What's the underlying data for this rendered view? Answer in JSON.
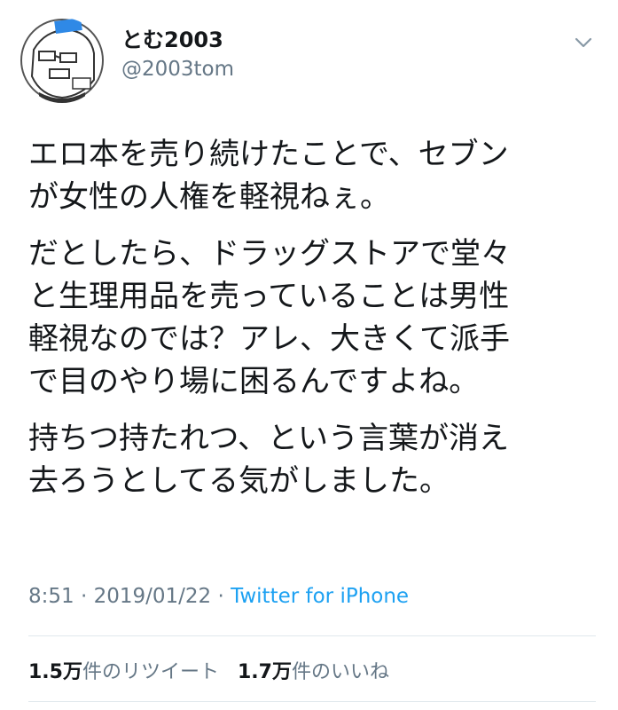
{
  "user": {
    "display_name": "とむ2003",
    "handle": "@2003tom",
    "avatar_icon": "cartoon-face-avatar-icon"
  },
  "menu_icon": "chevron-down-icon",
  "tweet": {
    "paragraphs": [
      "エロ本を売り続けたことで、セブン\nが女性の人権を軽視ねぇ。",
      "だとしたら、ドラッグストアで堂々\nと生理用品を売っていることは男性\n軽視なのでは？アレ、大きくて派手\nで目のやり場に困るんですよね。",
      "持ちつ持たれつ、という言葉が消え\n去ろうとしてる気がしました。"
    ]
  },
  "meta": {
    "time": "8:51",
    "separator": " · ",
    "date": "2019/01/22",
    "source": "Twitter for iPhone"
  },
  "stats": {
    "retweets_count": "1.5万",
    "retweets_label": "件のリツイート",
    "likes_count": "1.7万",
    "likes_label": "件のいいね"
  },
  "colors": {
    "text": "#14171a",
    "secondary": "#657786",
    "link": "#1da1f2",
    "divider": "#e1e8ed"
  }
}
